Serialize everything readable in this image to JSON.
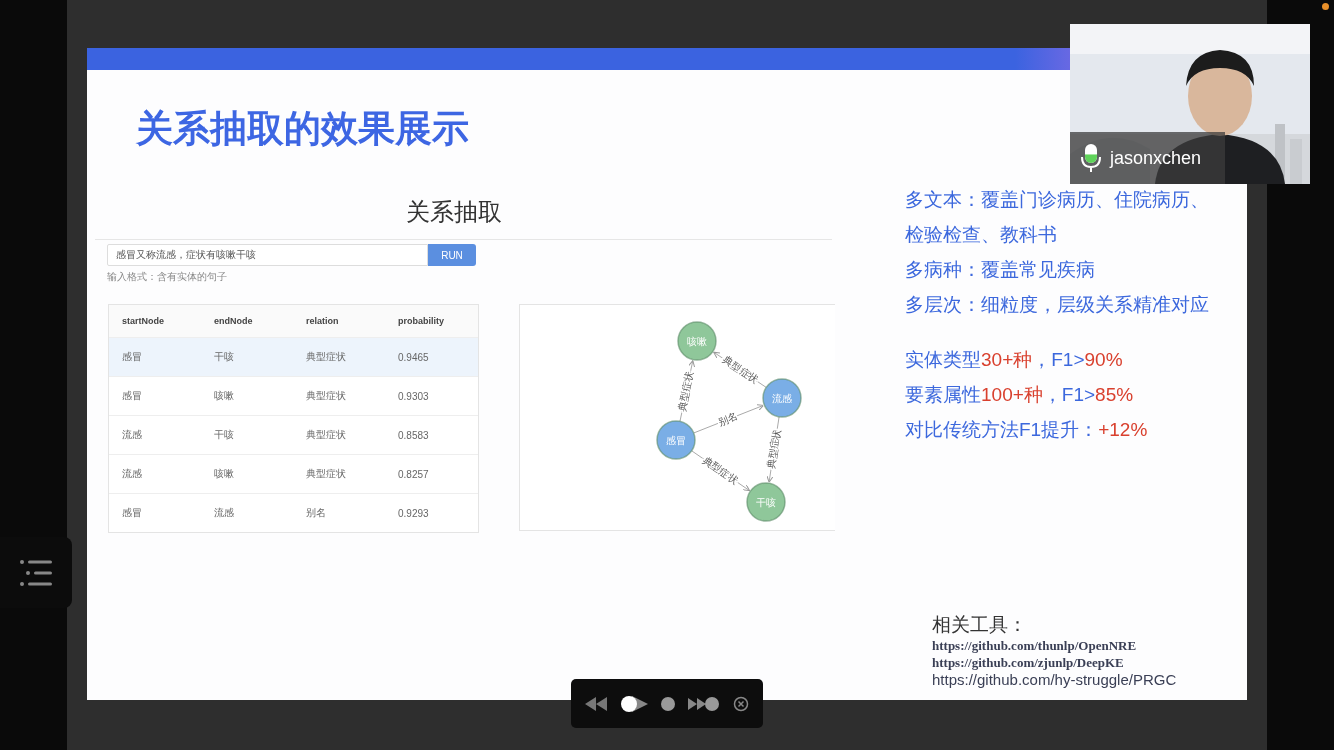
{
  "slide": {
    "title": "关系抽取的效果展示",
    "demo": {
      "heading": "关系抽取",
      "input": {
        "value": "感冒又称流感，症状有咳嗽干咳"
      },
      "run_button": "RUN",
      "hint": "输入格式：含有实体的句子",
      "table": {
        "columns": [
          "startNode",
          "endNode",
          "relation",
          "probability"
        ],
        "rows": [
          {
            "cells": [
              "感冒",
              "干咳",
              "典型症状",
              "0.9465"
            ],
            "selected": true
          },
          {
            "cells": [
              "感冒",
              "咳嗽",
              "典型症状",
              "0.9303"
            ],
            "selected": false
          },
          {
            "cells": [
              "流感",
              "干咳",
              "典型症状",
              "0.8583"
            ],
            "selected": false
          },
          {
            "cells": [
              "流感",
              "咳嗽",
              "典型症状",
              "0.8257"
            ],
            "selected": false
          },
          {
            "cells": [
              "感冒",
              "流感",
              "别名",
              "0.9293"
            ],
            "selected": false
          }
        ]
      },
      "graph": {
        "nodes": [
          {
            "label": "咳嗽",
            "color": "#8fc79a"
          },
          {
            "label": "流感",
            "color": "#7aaee6"
          },
          {
            "label": "感冒",
            "color": "#7aaee6"
          },
          {
            "label": "干咳",
            "color": "#8fc79a"
          }
        ],
        "edges": [
          {
            "label": "典型症状"
          },
          {
            "label": "典型症状"
          },
          {
            "label": "别名"
          },
          {
            "label": "典型症状"
          },
          {
            "label": "典型症状"
          }
        ]
      }
    },
    "points": [
      [
        {
          "text": "多文本：覆盖门诊病历、住院病历、",
          "kind": "normal"
        }
      ],
      [
        {
          "text": "检验检查、教科书",
          "kind": "normal"
        }
      ],
      [
        {
          "text": "多病种：覆盖常见疾病",
          "kind": "normal"
        }
      ],
      [
        {
          "text": "多层次：细粒度，层级关系精准对应",
          "kind": "normal"
        }
      ],
      [
        {
          "text": "实体类型",
          "kind": "normal"
        },
        {
          "text": "30+种",
          "kind": "highlight"
        },
        {
          "text": "，F1>",
          "kind": "normal"
        },
        {
          "text": "90%",
          "kind": "highlight"
        }
      ],
      [
        {
          "text": "要素属性",
          "kind": "normal"
        },
        {
          "text": "100+种",
          "kind": "highlight"
        },
        {
          "text": "，F1>",
          "kind": "normal"
        },
        {
          "text": "85%",
          "kind": "highlight"
        }
      ],
      [
        {
          "text": "对比传统方法F1提升：",
          "kind": "normal"
        },
        {
          "text": "+12%",
          "kind": "highlight"
        }
      ]
    ],
    "tools": {
      "label": "相关工具：",
      "links": [
        {
          "text": "https://github.com/thunlp/OpenNRE",
          "kind": "serif"
        },
        {
          "text": "https://github.com/zjunlp/DeepKE",
          "kind": "serif"
        },
        {
          "text": "https://github.com/hy-struggle/PRGC",
          "kind": "sans"
        }
      ]
    }
  },
  "video": {
    "participant": "jasonxchen",
    "mic": {
      "level": 0.45
    }
  }
}
